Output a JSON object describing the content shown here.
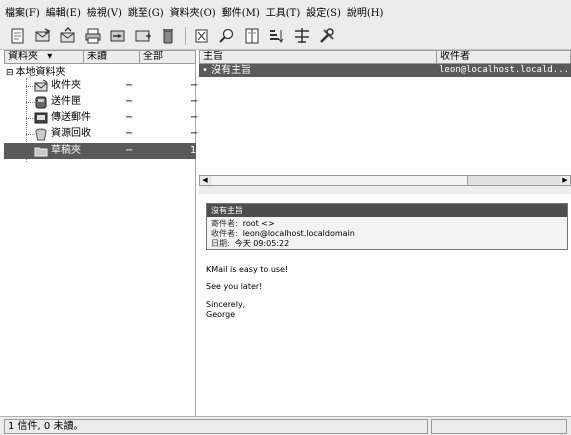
{
  "menu": [
    "檔案(F)",
    "編輯(E)",
    "檢視(V)",
    "跳至(G)",
    "資料夾(O)",
    "郵件(M)",
    "工具(T)",
    "設定(S)",
    "說明(H)"
  ],
  "toolbar_icons": [
    "new-message-icon",
    "reply-icon",
    "reply-all-icon",
    "print-icon",
    "forward-icon",
    "save-icon",
    "trash-icon",
    "new-mail-icon",
    "find-icon",
    "address-book-icon",
    "sort-icon",
    "filter-icon",
    "tools-icon"
  ],
  "folder_pane": {
    "headers": {
      "folder": "資料夾",
      "unread": "未讀",
      "total": "全部"
    },
    "root": "本地資料夾",
    "folders": [
      {
        "name": "收件夾",
        "unread": "−",
        "total": "−",
        "icon": "inbox-icon"
      },
      {
        "name": "送件匣",
        "unread": "−",
        "total": "−",
        "icon": "outbox-icon"
      },
      {
        "name": "傳送郵件",
        "unread": "−",
        "total": "−",
        "icon": "sent-mail-icon"
      },
      {
        "name": "資源回收",
        "unread": "−",
        "total": "−",
        "icon": "trash-folder-icon"
      },
      {
        "name": "草稿夾",
        "unread": "−",
        "total": "1",
        "icon": "drafts-folder-icon"
      }
    ]
  },
  "message_list": {
    "headers": {
      "subject": "主旨",
      "recipient": "收件者"
    },
    "rows": [
      {
        "subject": "沒有主旨",
        "recipient": "leon@localhost.locald..."
      }
    ]
  },
  "reader": {
    "title": "沒有主旨",
    "from_label": "寄件者:",
    "from": "root <>",
    "to_label": "收件者:",
    "to": "leon@localhost.localdomain",
    "date_label": "日期:",
    "date": "今天 09:05:22",
    "body": [
      "KMail is easy to use!",
      "See you later!",
      "Sincerely,",
      "George"
    ]
  },
  "status": {
    "text": "1 信件, 0 未讀。"
  }
}
